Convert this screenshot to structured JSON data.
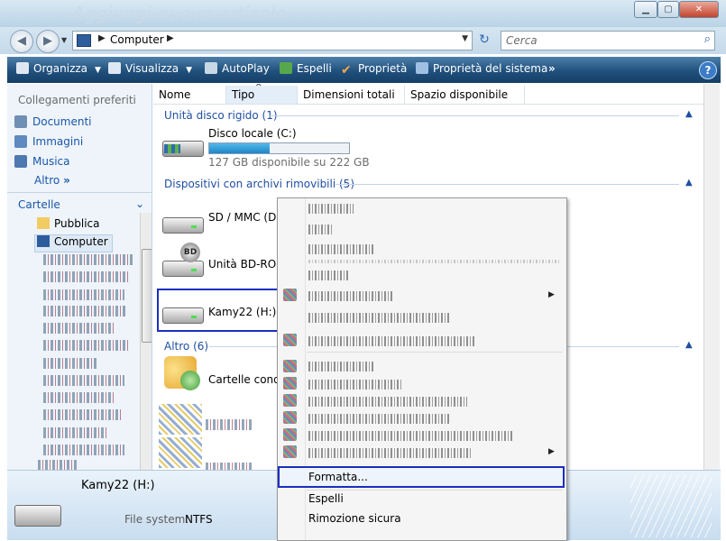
{
  "window": {
    "title": "Aggiungi nuovo articolo",
    "minimize": "▁",
    "maximize": "▢",
    "close": "✕"
  },
  "address": {
    "crumb": "Computer",
    "search_placeholder": "Cerca"
  },
  "toolbar": {
    "organizza": "Organizza",
    "visualizza": "Visualizza",
    "autoplay": "AutoPlay",
    "espelli": "Espelli",
    "proprieta": "Proprietà",
    "proprieta_sistema": "Proprietà del sistema",
    "more": "»",
    "help": "?"
  },
  "sidebar": {
    "favorites_header": "Collegamenti preferiti",
    "favorites": [
      "Documenti",
      "Immagini",
      "Musica"
    ],
    "altro": "Altro",
    "altro_chev": "»",
    "folders_header": "Cartelle",
    "tree": [
      "Pubblica",
      "Computer"
    ]
  },
  "columns": [
    "Nome",
    "Tipo",
    "Dimensioni totali",
    "Spazio disponibile"
  ],
  "groups": {
    "hdd": "Unità disco rigido (1)",
    "removable": "Dispositivi con archivi rimovibili (5)",
    "other": "Altro (6)"
  },
  "items": {
    "c_drive": "Disco locale (C:)",
    "c_drive_space": "127 GB disponibile su 222 GB",
    "c_drive_used_fraction": 0.43,
    "sd": "SD / MMC (D:)",
    "bd": "Unità BD-ROM",
    "bd_badge": "BD",
    "kamy": "Kamy22 (H:)",
    "shared": "Cartelle condiv"
  },
  "details": {
    "name": "Kamy22 (H:)",
    "fs_label": "File system:",
    "fs_value": "NTFS"
  },
  "context_menu": {
    "formatta": "Formatta...",
    "espelli": "Espelli",
    "rimozione": "Rimozione sicura"
  },
  "colors": {
    "toolbar": "#20507c",
    "selection_border": "#1a2ec0",
    "link": "#1a56a8"
  }
}
